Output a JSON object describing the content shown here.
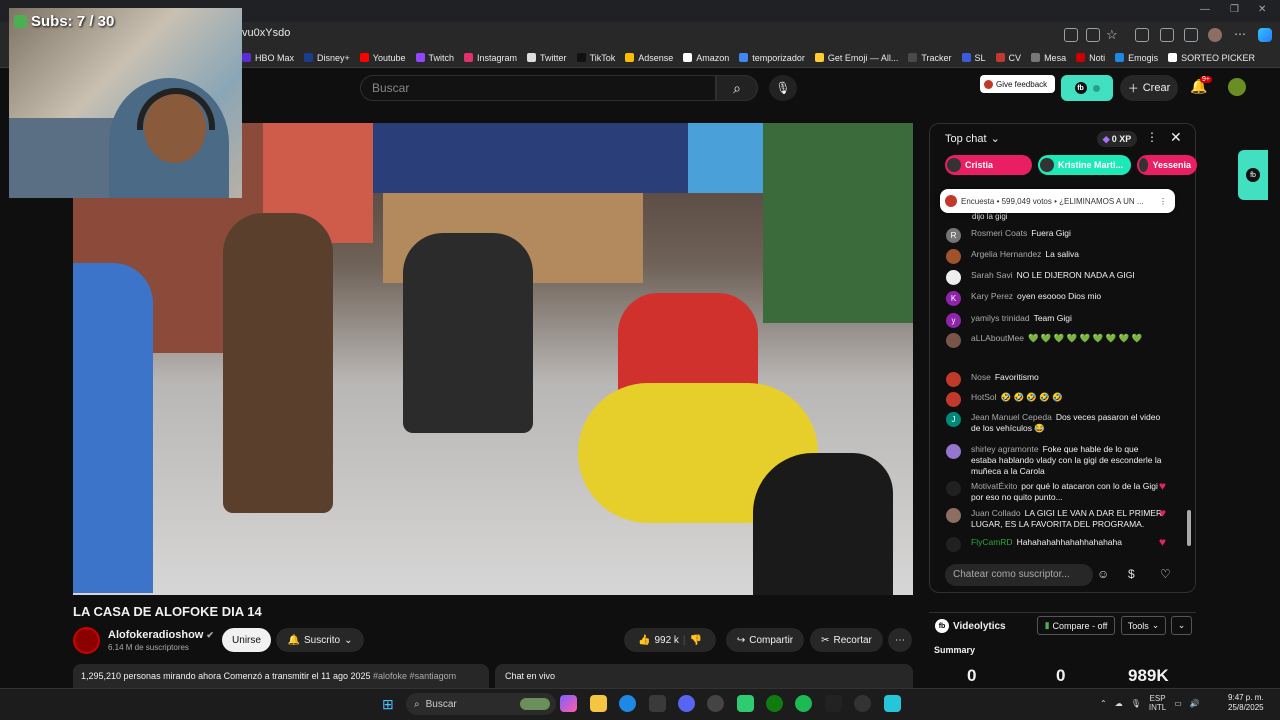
{
  "browser": {
    "url_fragment": "vu0xYsdo",
    "bookmarks": [
      {
        "label": "HBO Max",
        "color": "#5b2dd2"
      },
      {
        "label": "Disney+",
        "color": "#1a3d8f"
      },
      {
        "label": "Youtube",
        "color": "#ff0000"
      },
      {
        "label": "Twitch",
        "color": "#9146ff"
      },
      {
        "label": "Instagram",
        "color": "#e1306c"
      },
      {
        "label": "Twitter",
        "color": "#dddddd"
      },
      {
        "label": "TikTok",
        "color": "#111111"
      },
      {
        "label": "Adsense",
        "color": "#fbbc04"
      },
      {
        "label": "Amazon",
        "color": "#ffffff"
      },
      {
        "label": "temporizador",
        "color": "#4285f4"
      },
      {
        "label": "Get Emoji — All...",
        "color": "#ffcc33"
      },
      {
        "label": "Tracker",
        "color": "#4a4a4a"
      },
      {
        "label": "SL",
        "color": "#3b5bdb"
      },
      {
        "label": "CV",
        "color": "#c0392b"
      },
      {
        "label": "Mesa",
        "color": "#777777"
      },
      {
        "label": "Noti",
        "color": "#cc0000"
      },
      {
        "label": "Emogis",
        "color": "#1e88e5"
      },
      {
        "label": "SORTEO PICKER",
        "color": "#ffffff"
      }
    ]
  },
  "webcam": {
    "subs_label": "Subs: 7 / 30"
  },
  "youtube": {
    "search_placeholder": "Buscar",
    "feedback_label": "Give feedback",
    "create_label": "Crear",
    "notif_badge": "9+"
  },
  "video": {
    "title": "LA CASA DE ALOFOKE DIA 14",
    "channel": "Alofokeradioshow",
    "subscribers": "6.14 M de suscriptores",
    "join_label": "Unirse",
    "subscribed_label": "Suscrito",
    "likes": "992 k",
    "share_label": "Compartir",
    "clip_label": "Recortar",
    "description": "1,295,210 personas mirando ahora  Comenzó a transmitir el 11 ago 2025",
    "tags": "#alofoke #santiagom",
    "chat_live_label": "Chat en vivo"
  },
  "chat": {
    "mode_label": "Top chat",
    "xp": "0 XP",
    "donors": [
      {
        "name": "Cristia",
        "color": "#e91e63"
      },
      {
        "name": "Kristine Marti...",
        "color": "#1de9b6"
      },
      {
        "name": "Yessenia",
        "color": "#e91e63"
      }
    ],
    "poll_text": "Encuesta • 599,049 votos • ¿ELIMINAMOS A UN ...",
    "poll_cut": "dijo la gigi",
    "messages": [
      {
        "author": "Rosmeri Coats",
        "text": "Fuera Gigi",
        "initial": "R",
        "color": "#757575"
      },
      {
        "author": "Argelia Hernandez",
        "text": "La saliva",
        "initial": "",
        "color": "#a0522d"
      },
      {
        "author": "Sarah Savi",
        "text": "NO LE DIJERON NADA A GIGI",
        "initial": "",
        "color": "#eeeeee"
      },
      {
        "author": "Kary Perez",
        "text": "oyen esoooo Dios mio",
        "initial": "K",
        "color": "#8e24aa"
      },
      {
        "author": "yamilys trinidad",
        "text": "Team Gigi",
        "initial": "y",
        "color": "#8e24aa"
      },
      {
        "author": "aLLAboutMee",
        "text": "💚 💚 💚 💚 💚 💚 💚 💚 💚",
        "initial": "",
        "color": "#795548"
      },
      {
        "author": "Nose",
        "text": "Favoritismo",
        "initial": "",
        "color": "#c0392b"
      },
      {
        "author": "HotSol",
        "text": "🤣 🤣 🤣 🤣 🤣",
        "initial": "",
        "color": "#c0392b"
      },
      {
        "author": "Jean Manuel Cepeda",
        "text": "Dos veces pasaron el video de los vehículos 😂",
        "initial": "J",
        "color": "#00897b"
      },
      {
        "author": "shirley agramonte",
        "text": "Foke que hable de lo que estaba hablando vlady con la gigi de esconderle la muñeca a la Carola",
        "initial": "",
        "color": "#9575cd"
      },
      {
        "author": "MotivatÉxito",
        "text": "por qué lo atacaron con lo de la Gigi por eso no quito punto...",
        "initial": "",
        "color": "#212121"
      },
      {
        "author": "Juan Collado",
        "text": "LA GIGI LE VAN A DAR EL PRIMER LUGAR, ES LA FAVORITA DEL PROGRAMA.",
        "initial": "",
        "color": "#8d6e63"
      },
      {
        "author": "FlyCamRD",
        "text": "Hahahahahhahahhahahaha",
        "initial": "",
        "color": "#212121"
      }
    ],
    "input_placeholder": "Chatear como suscriptor..."
  },
  "videolytics": {
    "title": "Videolytics",
    "compare_label": "Compare - off",
    "tools_label": "Tools",
    "summary_label": "Summary",
    "values": [
      "0",
      "0",
      "989K"
    ]
  },
  "taskbar": {
    "search_label": "Buscar",
    "lang": "ESP",
    "layout": "INTL",
    "time": "9:47 p. m.",
    "date": "25/8/2025"
  }
}
